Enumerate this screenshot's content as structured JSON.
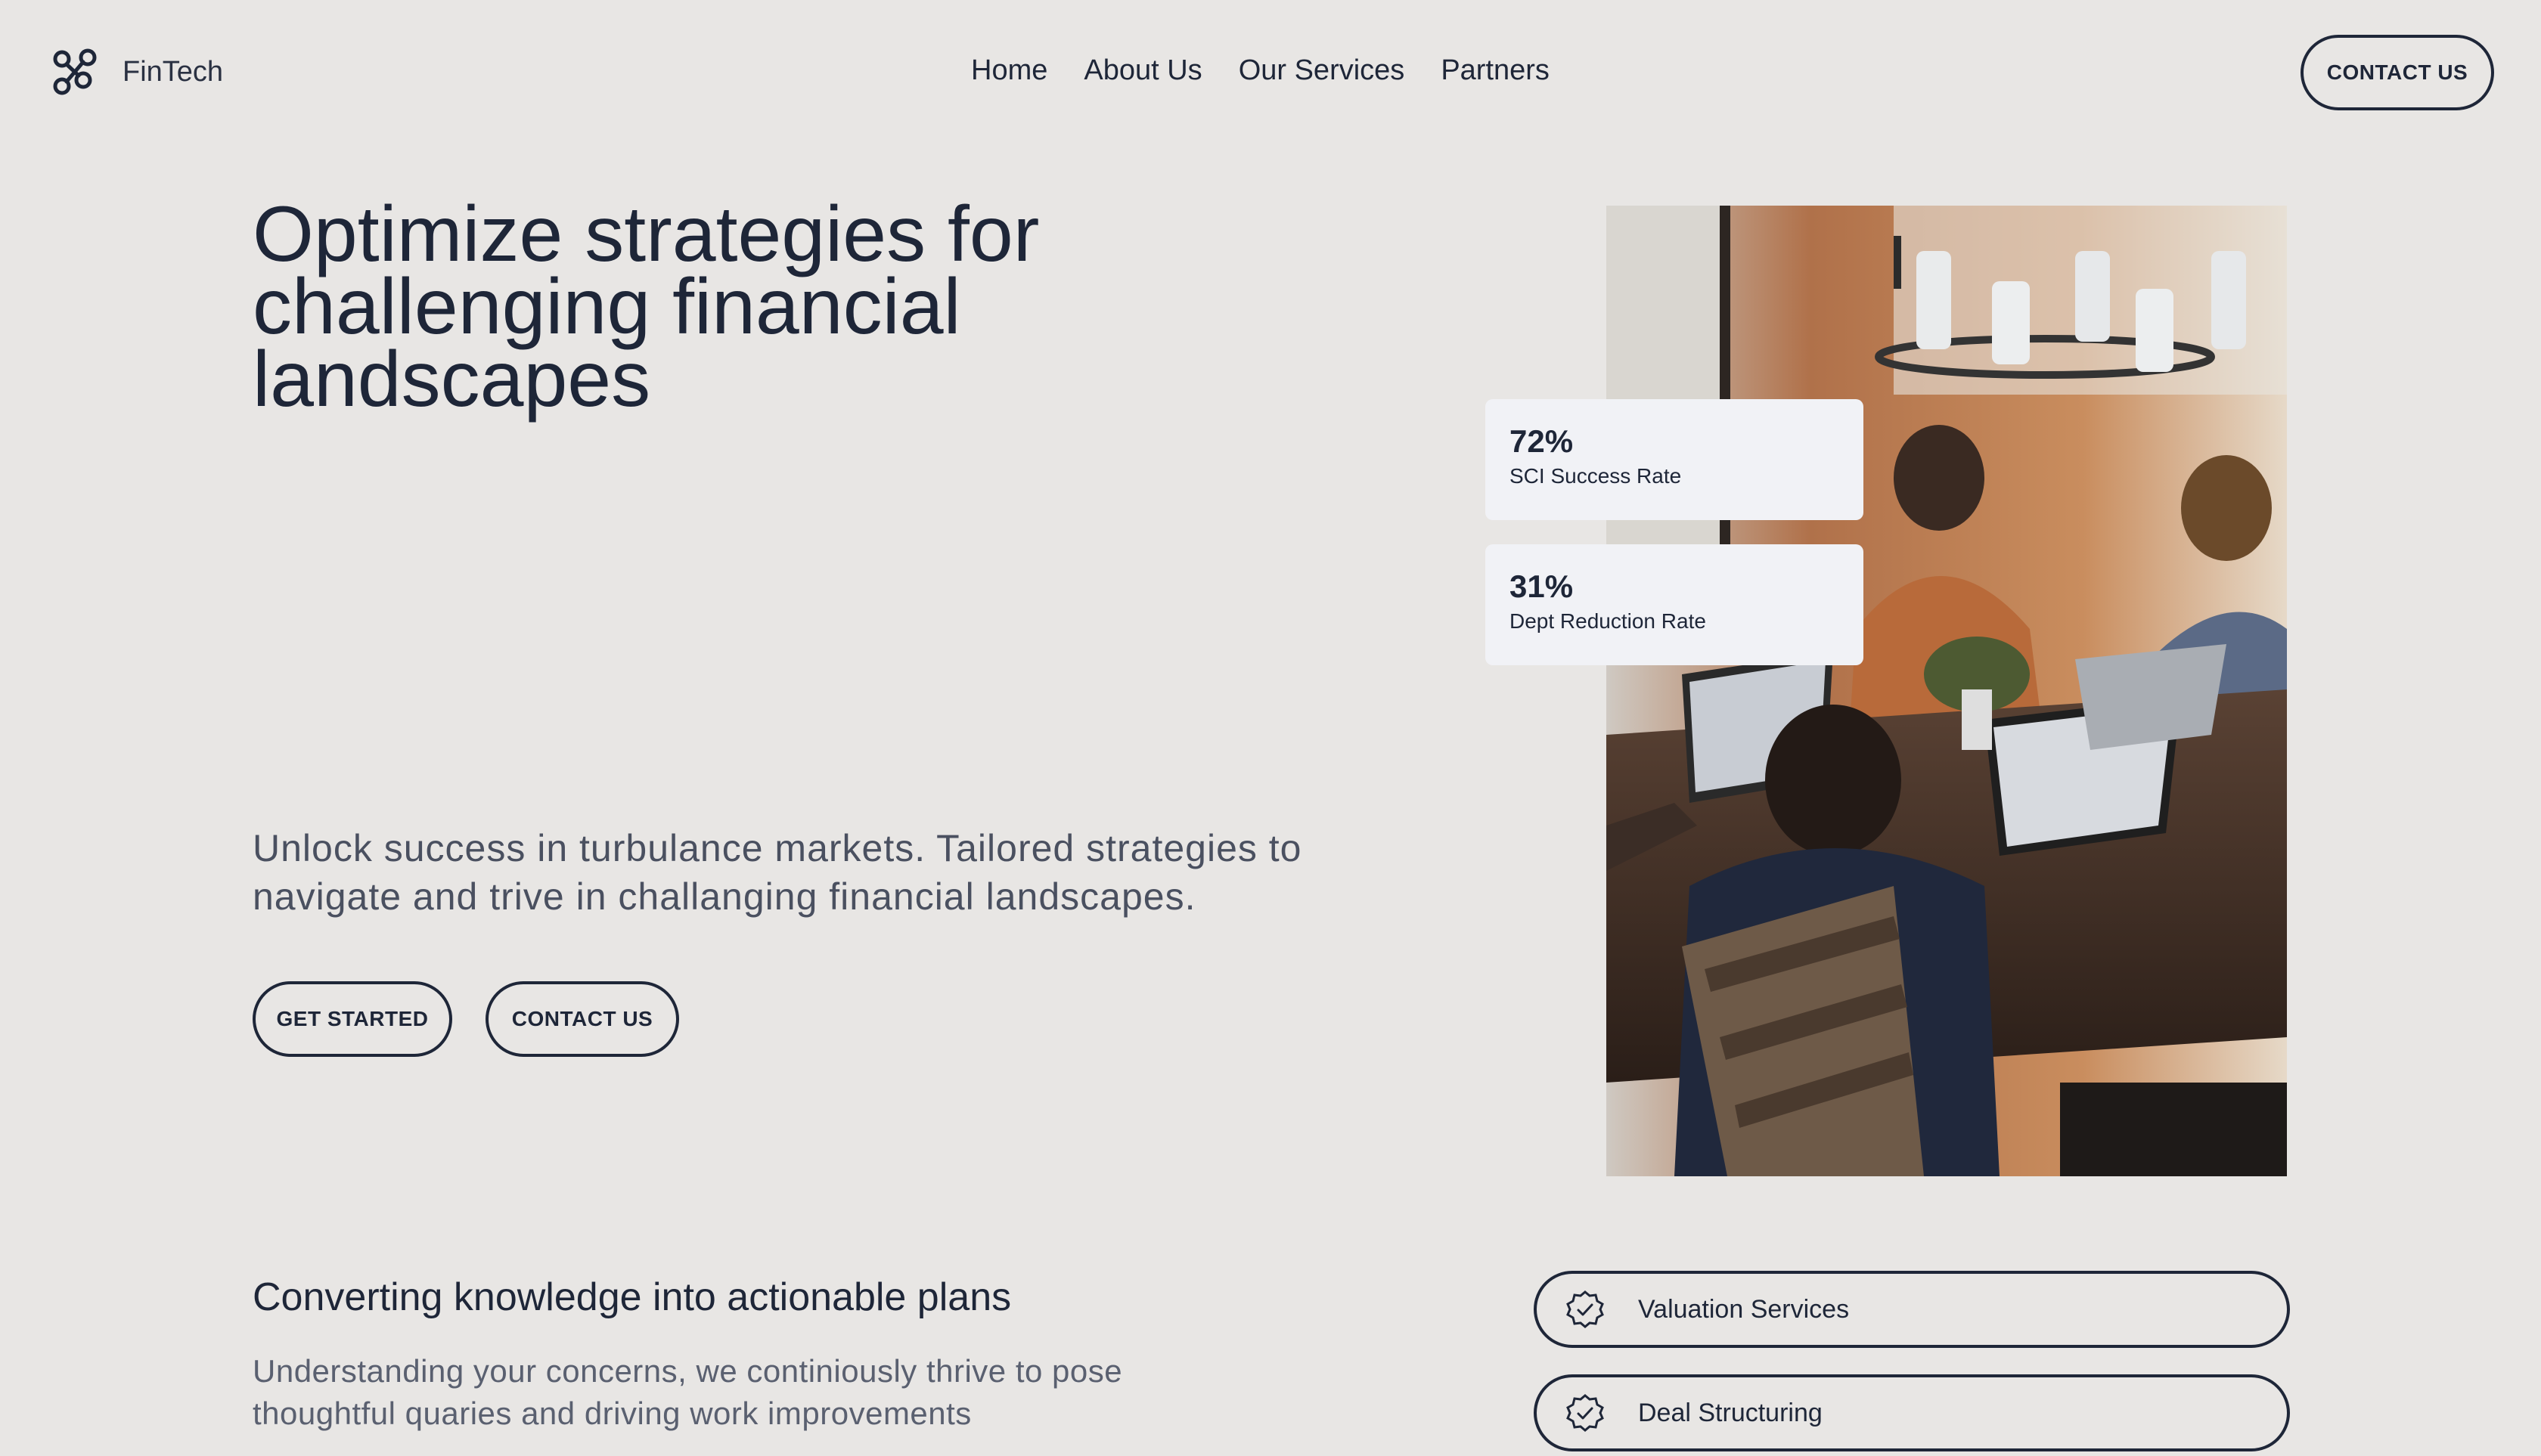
{
  "brand": {
    "name": "FinTech",
    "icon": "link-nodes-icon"
  },
  "nav": {
    "items": [
      {
        "label": "Home"
      },
      {
        "label": "About Us"
      },
      {
        "label": "Our Services"
      },
      {
        "label": "Partners"
      }
    ],
    "cta_label": "CONTACT US"
  },
  "hero": {
    "title_lines": [
      "Optimize strategies for",
      "challenging financial",
      "landscapes"
    ],
    "subtitle": "Unlock success in turbulance markets. Tailored strategies to navigate and trive in challanging financial landscapes.",
    "primary_button": "GET STARTED",
    "secondary_button": "CONTACT US"
  },
  "stats": [
    {
      "value": "72%",
      "label": "SCI Success Rate"
    },
    {
      "value": "31%",
      "label": "Dept Reduction Rate"
    }
  ],
  "section": {
    "title": "Converting knowledge into actionable plans",
    "text": "Understanding your concerns, we continiously thrive to pose thoughtful quaries and driving work improvements"
  },
  "services": [
    {
      "label": "Valuation Services",
      "icon": "badge-check-icon"
    },
    {
      "label": "Deal Structuring",
      "icon": "badge-check-icon"
    }
  ],
  "colors": {
    "background": "#e8e6e4",
    "text": "#1e2638",
    "card": "#f1f2f6"
  }
}
